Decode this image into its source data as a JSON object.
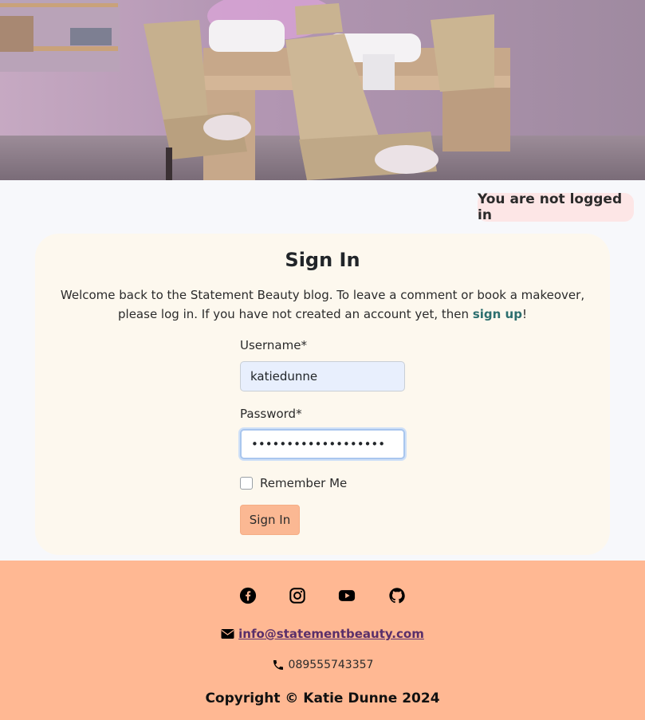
{
  "status": {
    "text": "You are not logged in"
  },
  "signin": {
    "title": "Sign In",
    "welcome_text": "Welcome back to the Statement Beauty blog. To leave a comment or book a makeover, please log in. If you have not created an account yet, then",
    "signup_link": "sign up",
    "welcome_end": "!",
    "username_label": "Username*",
    "username_value": "katiedunne",
    "password_label": "Password*",
    "password_value": "•••••••••••••••••••",
    "remember_label": "Remember Me",
    "submit_label": "Sign In"
  },
  "footer": {
    "social_icons": [
      "facebook-icon",
      "instagram-icon",
      "youtube-icon",
      "github-icon"
    ],
    "email": "info@statementbeauty.com",
    "phone": "089555743357",
    "copyright": "Copyright © Katie Dunne 2024"
  },
  "colors": {
    "footer_bg": "#ffb893",
    "card_bg": "#fdf8ee",
    "button_bg": "#fbb893",
    "badge_bg": "#fde6e6",
    "link": "#2b6e6e"
  }
}
